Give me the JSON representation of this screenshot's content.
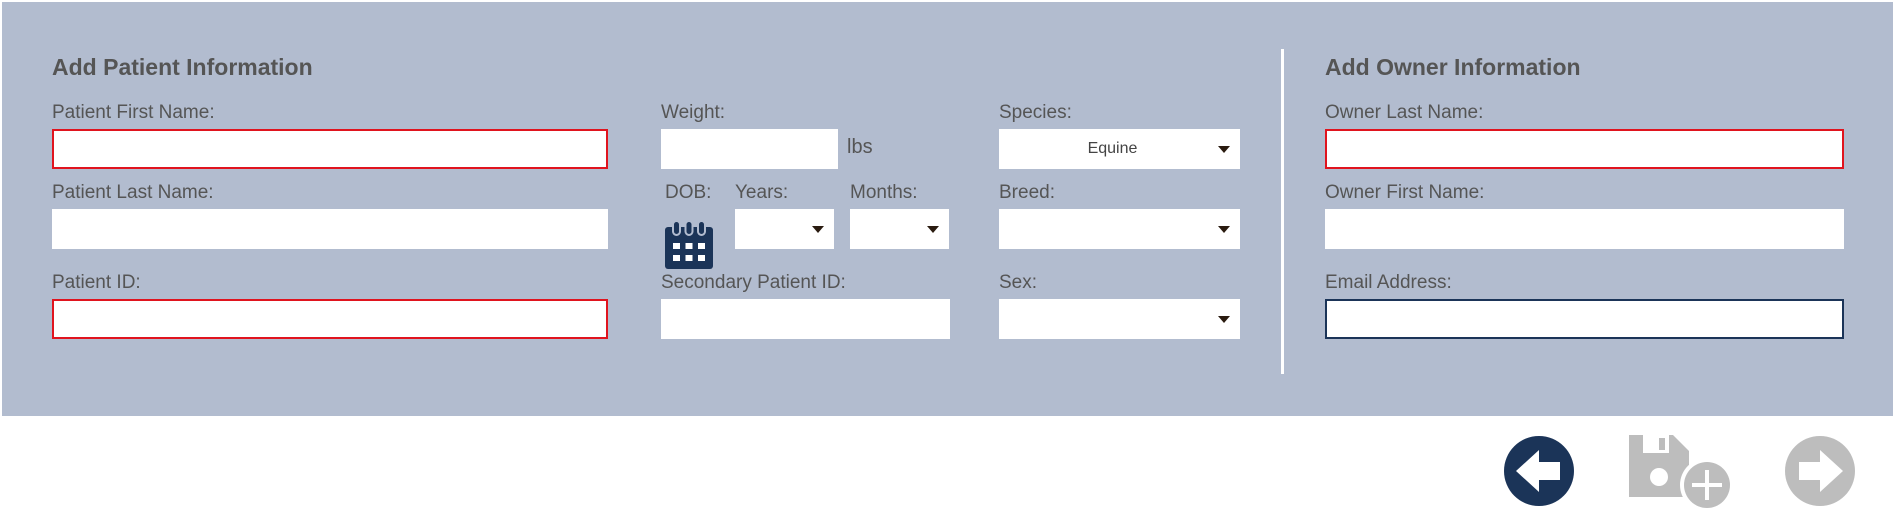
{
  "patient": {
    "heading": "Add Patient Information",
    "first_name_label": "Patient First Name:",
    "last_name_label": "Patient Last Name:",
    "id_label": "Patient ID:",
    "weight_label": "Weight:",
    "weight_unit": "lbs",
    "dob_label": "DOB:",
    "years_label": "Years:",
    "months_label": "Months:",
    "secondary_id_label": "Secondary Patient ID:",
    "species_label": "Species:",
    "species_value": "Equine",
    "breed_label": "Breed:",
    "sex_label": "Sex:"
  },
  "owner": {
    "heading": "Add Owner Information",
    "last_name_label": "Owner Last Name:",
    "first_name_label": "Owner First Name:",
    "email_label": "Email Address:"
  },
  "icons": {
    "calendar": "calendar-icon",
    "back": "arrow-left-icon",
    "save_add": "save-add-icon",
    "next": "arrow-right-icon"
  },
  "colors": {
    "panel_bg": "#b2bccf",
    "required_border": "#e0141e",
    "focus_border": "#1b3458",
    "accent": "#1b3458",
    "disabled": "#bdbdbd"
  }
}
